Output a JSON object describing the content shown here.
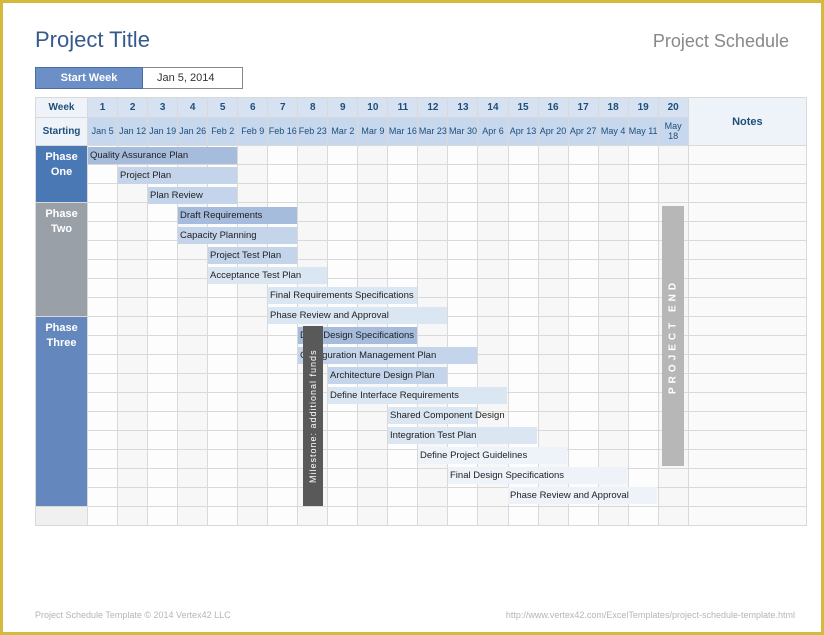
{
  "title": "Project Title",
  "subtitle": "Project Schedule",
  "start_week_label": "Start Week",
  "start_week_value": "Jan 5, 2014",
  "header_week_label": "Week",
  "header_starting_label": "Starting",
  "notes_label": "Notes",
  "weeks": [
    "1",
    "2",
    "3",
    "4",
    "5",
    "6",
    "7",
    "8",
    "9",
    "10",
    "11",
    "12",
    "13",
    "14",
    "15",
    "16",
    "17",
    "18",
    "19",
    "20"
  ],
  "dates": [
    "Jan 5",
    "Jan 12",
    "Jan 19",
    "Jan 26",
    "Feb 2",
    "Feb 9",
    "Feb 16",
    "Feb 23",
    "Mar 2",
    "Mar 9",
    "Mar 16",
    "Mar 23",
    "Mar 30",
    "Apr 6",
    "Apr 13",
    "Apr 20",
    "Apr 27",
    "May 4",
    "May 11",
    "May 18"
  ],
  "phases": [
    {
      "name": "Phase One",
      "rows": 3,
      "class": "phase-one"
    },
    {
      "name": "Phase Two",
      "rows": 6,
      "class": "phase-two"
    },
    {
      "name": "Phase Three",
      "rows": 10,
      "class": "phase-three"
    }
  ],
  "milestone_label": "Milestone: additional funds",
  "project_end_label": "PROJECT END",
  "footer_left": "Project Schedule Template © 2014 Vertex42 LLC",
  "footer_right": "http://www.vertex42.com/ExcelTemplates/project-schedule-template.html",
  "tasks": [
    {
      "row": 0,
      "start": 0,
      "span": 5,
      "shade": 1,
      "label": "Quality Assurance Plan"
    },
    {
      "row": 1,
      "start": 1,
      "span": 4,
      "shade": 2,
      "label": "Project Plan"
    },
    {
      "row": 2,
      "start": 2,
      "span": 3,
      "shade": 2,
      "label": "Plan Review"
    },
    {
      "row": 3,
      "start": 3,
      "span": 4,
      "shade": 1,
      "label": "Draft Requirements"
    },
    {
      "row": 4,
      "start": 3,
      "span": 4,
      "shade": 2,
      "label": "Capacity Planning"
    },
    {
      "row": 5,
      "start": 4,
      "span": 3,
      "shade": 2,
      "label": "Project Test Plan"
    },
    {
      "row": 6,
      "start": 4,
      "span": 4,
      "shade": 3,
      "label": "Acceptance Test Plan"
    },
    {
      "row": 7,
      "start": 6,
      "span": 5,
      "shade": 3,
      "label": "Final Requirements Specifications"
    },
    {
      "row": 8,
      "start": 6,
      "span": 6,
      "shade": 3,
      "label": "Phase Review and Approval"
    },
    {
      "row": 9,
      "start": 7,
      "span": 4,
      "shade": 1,
      "label": "Draft Design Specifications"
    },
    {
      "row": 10,
      "start": 7,
      "span": 6,
      "shade": 2,
      "label": "Configuration Management Plan"
    },
    {
      "row": 11,
      "start": 8,
      "span": 4,
      "shade": 2,
      "label": "Architecture Design Plan"
    },
    {
      "row": 12,
      "start": 8,
      "span": 6,
      "shade": 3,
      "label": "Define Interface Requirements"
    },
    {
      "row": 13,
      "start": 10,
      "span": 3,
      "shade": 3,
      "label": "Shared Component Design"
    },
    {
      "row": 14,
      "start": 10,
      "span": 5,
      "shade": 3,
      "label": "Integration Test Plan"
    },
    {
      "row": 15,
      "start": 11,
      "span": 5,
      "shade": 4,
      "label": "Define Project Guidelines"
    },
    {
      "row": 16,
      "start": 12,
      "span": 6,
      "shade": 4,
      "label": "Final Design Specifications"
    },
    {
      "row": 17,
      "start": 14,
      "span": 5,
      "shade": 4,
      "label": "Phase Review and Approval"
    }
  ],
  "chart_data": {
    "type": "gantt",
    "title": "Project Schedule",
    "x_unit": "week",
    "x_start_date": "2014-01-05",
    "x_categories": [
      1,
      2,
      3,
      4,
      5,
      6,
      7,
      8,
      9,
      10,
      11,
      12,
      13,
      14,
      15,
      16,
      17,
      18,
      19,
      20
    ],
    "x_dates": [
      "Jan 5",
      "Jan 12",
      "Jan 19",
      "Jan 26",
      "Feb 2",
      "Feb 9",
      "Feb 16",
      "Feb 23",
      "Mar 2",
      "Mar 9",
      "Mar 16",
      "Mar 23",
      "Mar 30",
      "Apr 6",
      "Apr 13",
      "Apr 20",
      "Apr 27",
      "May 4",
      "May 11",
      "May 18"
    ],
    "series": [
      {
        "phase": "Phase One",
        "task": "Quality Assurance Plan",
        "start_week": 1,
        "duration_weeks": 5
      },
      {
        "phase": "Phase One",
        "task": "Project Plan",
        "start_week": 2,
        "duration_weeks": 4
      },
      {
        "phase": "Phase One",
        "task": "Plan Review",
        "start_week": 3,
        "duration_weeks": 3
      },
      {
        "phase": "Phase Two",
        "task": "Draft Requirements",
        "start_week": 4,
        "duration_weeks": 4
      },
      {
        "phase": "Phase Two",
        "task": "Capacity Planning",
        "start_week": 4,
        "duration_weeks": 4
      },
      {
        "phase": "Phase Two",
        "task": "Project Test Plan",
        "start_week": 5,
        "duration_weeks": 3
      },
      {
        "phase": "Phase Two",
        "task": "Acceptance Test Plan",
        "start_week": 5,
        "duration_weeks": 4
      },
      {
        "phase": "Phase Two",
        "task": "Final Requirements Specifications",
        "start_week": 7,
        "duration_weeks": 5
      },
      {
        "phase": "Phase Two",
        "task": "Phase Review and Approval",
        "start_week": 7,
        "duration_weeks": 6
      },
      {
        "phase": "Phase Three",
        "task": "Draft Design Specifications",
        "start_week": 8,
        "duration_weeks": 4
      },
      {
        "phase": "Phase Three",
        "task": "Configuration Management Plan",
        "start_week": 8,
        "duration_weeks": 6
      },
      {
        "phase": "Phase Three",
        "task": "Architecture Design Plan",
        "start_week": 9,
        "duration_weeks": 4
      },
      {
        "phase": "Phase Three",
        "task": "Define Interface Requirements",
        "start_week": 9,
        "duration_weeks": 6
      },
      {
        "phase": "Phase Three",
        "task": "Shared Component Design",
        "start_week": 11,
        "duration_weeks": 3
      },
      {
        "phase": "Phase Three",
        "task": "Integration Test Plan",
        "start_week": 11,
        "duration_weeks": 5
      },
      {
        "phase": "Phase Three",
        "task": "Define Project Guidelines",
        "start_week": 12,
        "duration_weeks": 5
      },
      {
        "phase": "Phase Three",
        "task": "Final Design Specifications",
        "start_week": 13,
        "duration_weeks": 6
      },
      {
        "phase": "Phase Three",
        "task": "Phase Review and Approval",
        "start_week": 15,
        "duration_weeks": 5
      }
    ],
    "milestones": [
      {
        "label": "Milestone: additional funds",
        "week": 8
      },
      {
        "label": "PROJECT END",
        "week": 20
      }
    ]
  }
}
